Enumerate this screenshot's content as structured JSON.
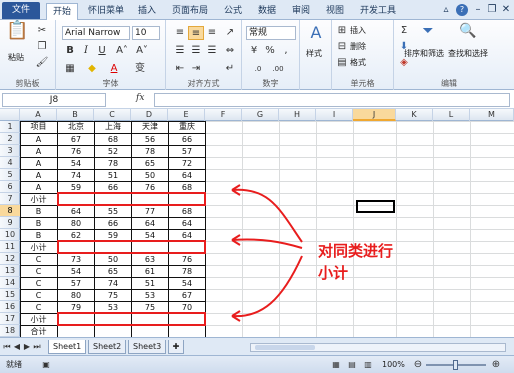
{
  "tabs": [
    "文件",
    "开始",
    "怀旧菜单",
    "插入",
    "页面布局",
    "公式",
    "数据",
    "审阅",
    "视图",
    "开发工具"
  ],
  "ribbon": {
    "paste": "粘贴",
    "font_name": "Arial Narrow",
    "font_size": "10",
    "number_format": "常规",
    "insert": "插入",
    "delete": "删除",
    "format": "格式",
    "styles": "样式",
    "sort_filter": "排序和筛选",
    "find_select": "查找和选择",
    "groups": [
      "剪贴板",
      "字体",
      "对齐方式",
      "数字",
      "单元格",
      "编辑"
    ]
  },
  "formula_bar": {
    "name_box": "J8",
    "fx": "fx",
    "value": ""
  },
  "columns": [
    "A",
    "B",
    "C",
    "D",
    "E",
    "F",
    "G",
    "H",
    "I",
    "J",
    "K",
    "L",
    "M"
  ],
  "rows": [
    "1",
    "2",
    "3",
    "4",
    "5",
    "6",
    "7",
    "8",
    "9",
    "10",
    "11",
    "12",
    "13",
    "14",
    "15",
    "16",
    "17",
    "18"
  ],
  "table": {
    "header": [
      "项目",
      "北京",
      "上海",
      "天津",
      "重庆"
    ],
    "rows": [
      [
        "A",
        "67",
        "68",
        "56",
        "66"
      ],
      [
        "A",
        "76",
        "52",
        "78",
        "57"
      ],
      [
        "A",
        "54",
        "78",
        "65",
        "72"
      ],
      [
        "A",
        "74",
        "51",
        "50",
        "64"
      ],
      [
        "A",
        "59",
        "66",
        "76",
        "68"
      ],
      [
        "小计",
        "",
        "",
        "",
        ""
      ],
      [
        "B",
        "64",
        "55",
        "77",
        "68"
      ],
      [
        "B",
        "80",
        "66",
        "64",
        "64"
      ],
      [
        "B",
        "62",
        "59",
        "54",
        "64"
      ],
      [
        "小计",
        "",
        "",
        "",
        ""
      ],
      [
        "C",
        "73",
        "50",
        "63",
        "76"
      ],
      [
        "C",
        "54",
        "65",
        "61",
        "78"
      ],
      [
        "C",
        "57",
        "74",
        "51",
        "54"
      ],
      [
        "C",
        "80",
        "75",
        "53",
        "67"
      ],
      [
        "C",
        "79",
        "53",
        "75",
        "70"
      ],
      [
        "小计",
        "",
        "",
        "",
        ""
      ],
      [
        "合计",
        "",
        "",
        "",
        ""
      ]
    ]
  },
  "annotation": {
    "line1": "对同类进行",
    "line2": "小计"
  },
  "sheets": [
    "Sheet1",
    "Sheet2",
    "Sheet3"
  ],
  "status": {
    "mode": "就绪",
    "zoom": "100%"
  },
  "colors": {
    "annotation": "#e81d1d",
    "file_tab": "#2b579a",
    "selection": "#f9d99c"
  }
}
